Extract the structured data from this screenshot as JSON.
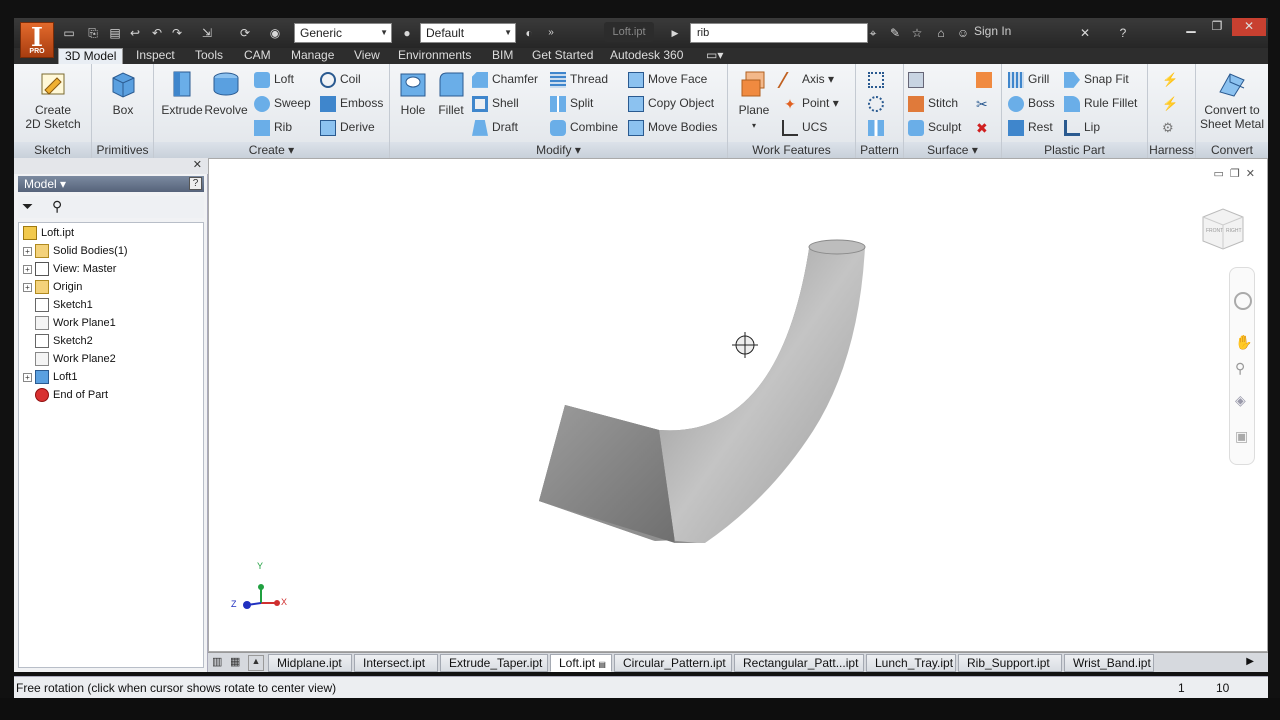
{
  "app": {
    "logo_letter": "I",
    "logo_badge": "PRO",
    "material": "Generic",
    "appearance": "Default",
    "document_title": "Loft.ipt",
    "search_value": "rib",
    "sign_in": "Sign In"
  },
  "tabs": [
    "3D Model",
    "Inspect",
    "Tools",
    "CAM",
    "Manage",
    "View",
    "Environments",
    "BIM",
    "Get Started",
    "Autodesk 360"
  ],
  "ribbon": {
    "sketch": {
      "title": "Sketch",
      "create_2d_line1": "Create",
      "create_2d_line2": "2D Sketch"
    },
    "primitives": {
      "title": "Primitives",
      "box": "Box"
    },
    "create": {
      "title": "Create",
      "extrude": "Extrude",
      "revolve": "Revolve",
      "loft": "Loft",
      "sweep": "Sweep",
      "rib": "Rib",
      "coil": "Coil",
      "emboss": "Emboss",
      "derive": "Derive"
    },
    "modify": {
      "title": "Modify",
      "hole": "Hole",
      "fillet": "Fillet",
      "chamfer": "Chamfer",
      "shell": "Shell",
      "draft": "Draft",
      "thread": "Thread",
      "split": "Split",
      "combine": "Combine",
      "move_face": "Move Face",
      "copy_object": "Copy Object",
      "move_bodies": "Move Bodies"
    },
    "work_features": {
      "title": "Work Features",
      "plane": "Plane",
      "axis": "Axis",
      "point": "Point",
      "ucs": "UCS"
    },
    "pattern": {
      "title": "Pattern"
    },
    "surface": {
      "title": "Surface",
      "stitch": "Stitch",
      "sculpt": "Sculpt"
    },
    "plastic_part": {
      "title": "Plastic Part",
      "grill": "Grill",
      "boss": "Boss",
      "rest": "Rest",
      "snap_fit": "Snap Fit",
      "rule_fillet": "Rule Fillet",
      "lip": "Lip"
    },
    "harness": {
      "title": "Harness"
    },
    "convert": {
      "title": "Convert",
      "line1": "Convert to",
      "line2": "Sheet Metal"
    }
  },
  "browser": {
    "header": "Model",
    "tree": [
      {
        "label": "Loft.ipt",
        "icon": "part-icon",
        "expand": false,
        "indent": 0
      },
      {
        "label": "Solid Bodies(1)",
        "icon": "folder-icon",
        "expand": true,
        "indent": 1
      },
      {
        "label": "View: Master",
        "icon": "view-icon",
        "expand": true,
        "indent": 1
      },
      {
        "label": "Origin",
        "icon": "folder-icon",
        "expand": true,
        "indent": 1
      },
      {
        "label": "Sketch1",
        "icon": "sketch-icon",
        "expand": false,
        "indent": 1
      },
      {
        "label": "Work Plane1",
        "icon": "workplane-icon",
        "expand": false,
        "indent": 1
      },
      {
        "label": "Sketch2",
        "icon": "sketch-icon",
        "expand": false,
        "indent": 1
      },
      {
        "label": "Work Plane2",
        "icon": "workplane-icon",
        "expand": false,
        "indent": 1
      },
      {
        "label": "Loft1",
        "icon": "loft-icon",
        "expand": true,
        "indent": 1
      },
      {
        "label": "End of Part",
        "icon": "end-of-part-icon",
        "expand": false,
        "indent": 1
      }
    ]
  },
  "viewport": {
    "triad": {
      "x": "X",
      "y": "Y",
      "z": "Z"
    },
    "viewcube": {
      "left": "FRONT",
      "right": "RIGHT"
    }
  },
  "doc_tabs": [
    "Midplane.ipt",
    "Intersect.ipt",
    "Extrude_Taper.ipt",
    "Loft.ipt",
    "Circular_Pattern.ipt",
    "Rectangular_Patt...ipt",
    "Lunch_Tray.ipt",
    "Rib_Support.ipt",
    "Wrist_Band.ipt"
  ],
  "active_doc_tab": "Loft.ipt",
  "status": {
    "message": "Free rotation (click when cursor shows rotate to center view)",
    "count1": "1",
    "count2": "10"
  },
  "colors": {
    "accent": "#e36a2c",
    "ribbon_bg": "#eef1f4",
    "titlebar": "#2d2d2d"
  }
}
